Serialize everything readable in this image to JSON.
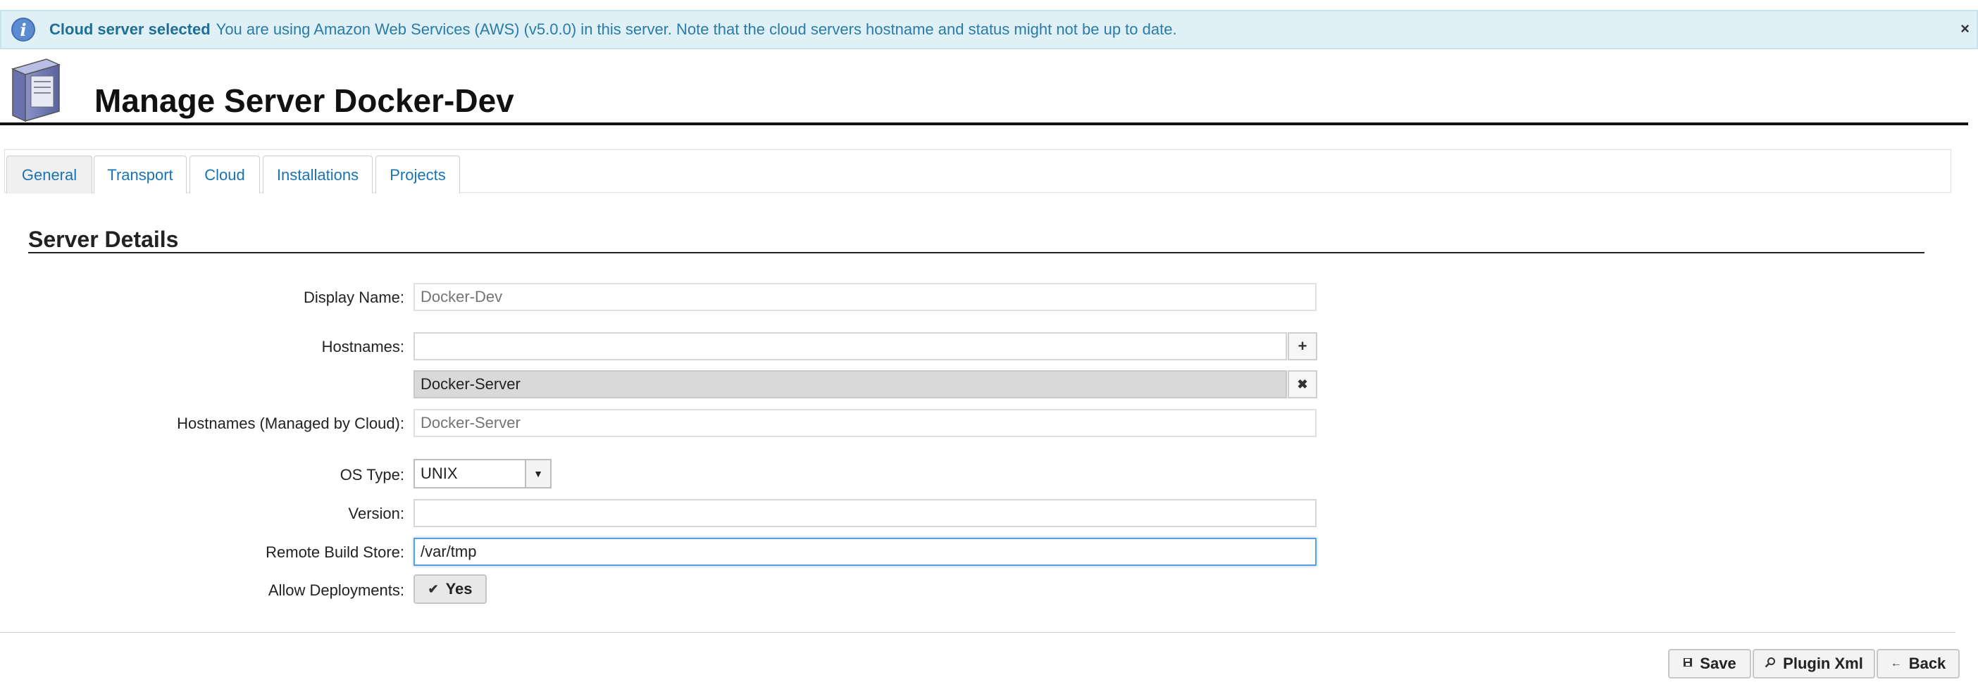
{
  "banner": {
    "icon": "info-icon",
    "title": "Cloud server selected",
    "message": "You are using Amazon Web Services (AWS) (v5.0.0) in this server. Note that the cloud servers hostname and status might not be up to date.",
    "close": "×"
  },
  "header": {
    "icon": "server-icon",
    "title": "Manage Server Docker-Dev"
  },
  "tabs": [
    {
      "label": "General",
      "active": true
    },
    {
      "label": "Transport"
    },
    {
      "label": "Cloud"
    },
    {
      "label": "Installations"
    },
    {
      "label": "Projects"
    }
  ],
  "section": {
    "title": "Server Details"
  },
  "form": {
    "display_name_label": "Display Name:",
    "display_name_placeholder": "Docker-Dev",
    "hostnames_label": "Hostnames:",
    "hostname_input_value": "",
    "add_hostname": "+",
    "hostname_entries": [
      "Docker-Server"
    ],
    "remove_hostname": "✖",
    "managed_label": "Hostnames (Managed by Cloud):",
    "managed_placeholder": "Docker-Server",
    "os_type_label": "OS Type:",
    "os_type_value": "UNIX",
    "version_label": "Version:",
    "version_value": "",
    "remote_build_store_label": "Remote Build Store:",
    "remote_build_store_value": "/var/tmp",
    "allow_deployments_label": "Allow Deployments:",
    "allow_deployments_value": "Yes"
  },
  "footer": {
    "save_label": "Save",
    "plugin_xml_label": "Plugin Xml",
    "back_label": "Back"
  },
  "colors": {
    "link": "#1a73b5",
    "banner_bg": "#dff0f6",
    "banner_title": "#1f6f95"
  }
}
